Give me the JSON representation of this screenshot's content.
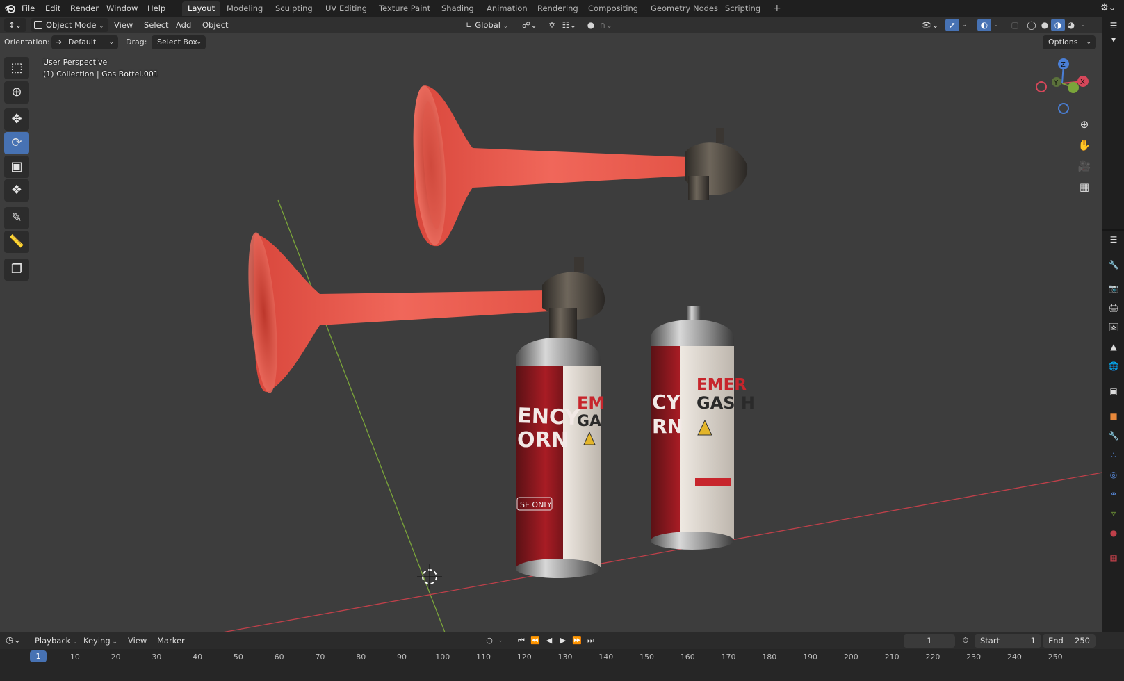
{
  "topbar": {
    "menus": [
      "File",
      "Edit",
      "Render",
      "Window",
      "Help"
    ],
    "workspaces": [
      "Layout",
      "Modeling",
      "Sculpting",
      "UV Editing",
      "Texture Paint",
      "Shading",
      "Animation",
      "Rendering",
      "Compositing",
      "Geometry Nodes",
      "Scripting"
    ],
    "active_workspace": "Layout",
    "add_tab": "+"
  },
  "header": {
    "mode": "Object Mode",
    "menus": [
      "View",
      "Select",
      "Add",
      "Object"
    ],
    "transform_orientation": "Global"
  },
  "tool_settings": {
    "orientation_label": "Orientation:",
    "orientation_value": "Default",
    "drag_label": "Drag:",
    "drag_value": "Select Box",
    "options": "Options"
  },
  "viewport": {
    "view_name": "User Perspective",
    "collection_info": "(1) Collection | Gas Bottel.001",
    "gizmo": {
      "x": "X",
      "y": "Y",
      "z": "Z"
    },
    "colors": {
      "background": "#3d3d3d",
      "horn": "#e85a4f",
      "x_axis": "#c0404a",
      "y_axis": "#7aa53a"
    }
  },
  "timeline": {
    "menus": [
      "Playback",
      "Keying",
      "View",
      "Marker"
    ],
    "current_frame": "1",
    "start_label": "Start",
    "start_value": "1",
    "end_label": "End",
    "end_value": "250",
    "ticks": [
      "10",
      "20",
      "30",
      "40",
      "50",
      "60",
      "70",
      "80",
      "90",
      "100",
      "110",
      "120",
      "130",
      "140",
      "150",
      "160",
      "170",
      "180",
      "190",
      "200",
      "210",
      "220",
      "230",
      "240",
      "250"
    ],
    "playhead_label": "1"
  }
}
